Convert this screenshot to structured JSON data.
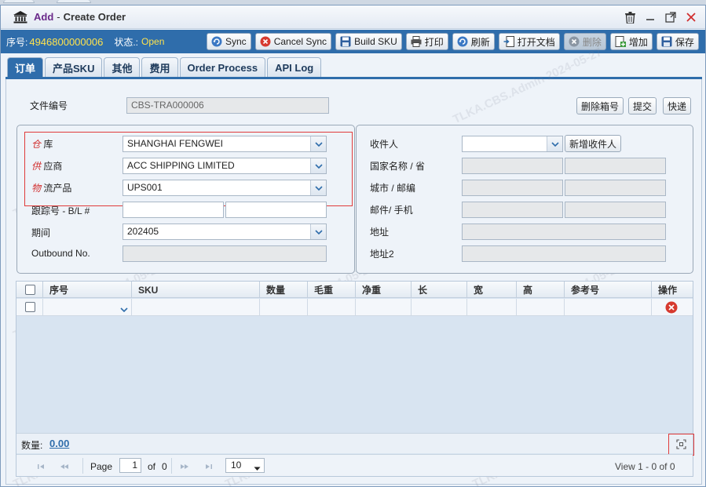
{
  "window": {
    "title_prefix": "Add",
    "title_separator": "-",
    "title": "Create Order"
  },
  "toolbar": {
    "seq_label": "序号:",
    "seq_value": "4946800000006",
    "status_label": "状态.:",
    "status_value": "Open",
    "buttons": [
      "Sync",
      "Cancel Sync",
      "Build SKU",
      "打印",
      "刷新",
      "打开文档",
      "删除",
      "增加",
      "保存"
    ]
  },
  "tabs": [
    "订单",
    "产品SKU",
    "其他",
    "费用",
    "Order Process",
    "API Log"
  ],
  "form": {
    "doc_no_label": "文件编号",
    "doc_no_value": "CBS-TRA000006",
    "action_buttons": [
      "删除箱号",
      "提交",
      "快递"
    ],
    "warehouse_label_red": "仓",
    "warehouse_label_rest": "库",
    "warehouse_value": "SHANGHAI FENGWEI",
    "supplier_label_red": "供",
    "supplier_label_rest": "应商",
    "supplier_value": "ACC SHIPPING LIMITED",
    "logistics_label_red": "物",
    "logistics_label_rest": "流产品",
    "logistics_value": "UPS001",
    "tracking_label": "跟踪号 -  B/L #",
    "period_label": "期间",
    "period_value": "202405",
    "outbound_label": "Outbound No.",
    "receiver_label": "收件人",
    "add_receiver_button": "新增收件人",
    "country_label": "国家名称 / 省",
    "city_label": "城市 / 邮编",
    "mail_label": "邮件/ 手机",
    "address_label": "地址",
    "address2_label": "地址2"
  },
  "grid": {
    "columns": [
      "序号",
      "SKU",
      "数量",
      "毛重",
      "净重",
      "长",
      "宽",
      "高",
      "参考号",
      "操作"
    ],
    "summary_label": "数量:",
    "summary_value": "0.00",
    "pager": {
      "page_label": "Page",
      "page_value": "1",
      "of_label": "of",
      "total_pages": "0",
      "page_size": "10",
      "view_text": "View 1 - 0 of 0"
    }
  },
  "watermark": "TLKA.CBS.Admin 2024-05-27",
  "colors": {
    "toolbar_bg": "#2f6dab",
    "highlight_yellow": "#ffe34d",
    "accent_red": "#e03b3b",
    "title_purple": "#6b2a8a"
  }
}
